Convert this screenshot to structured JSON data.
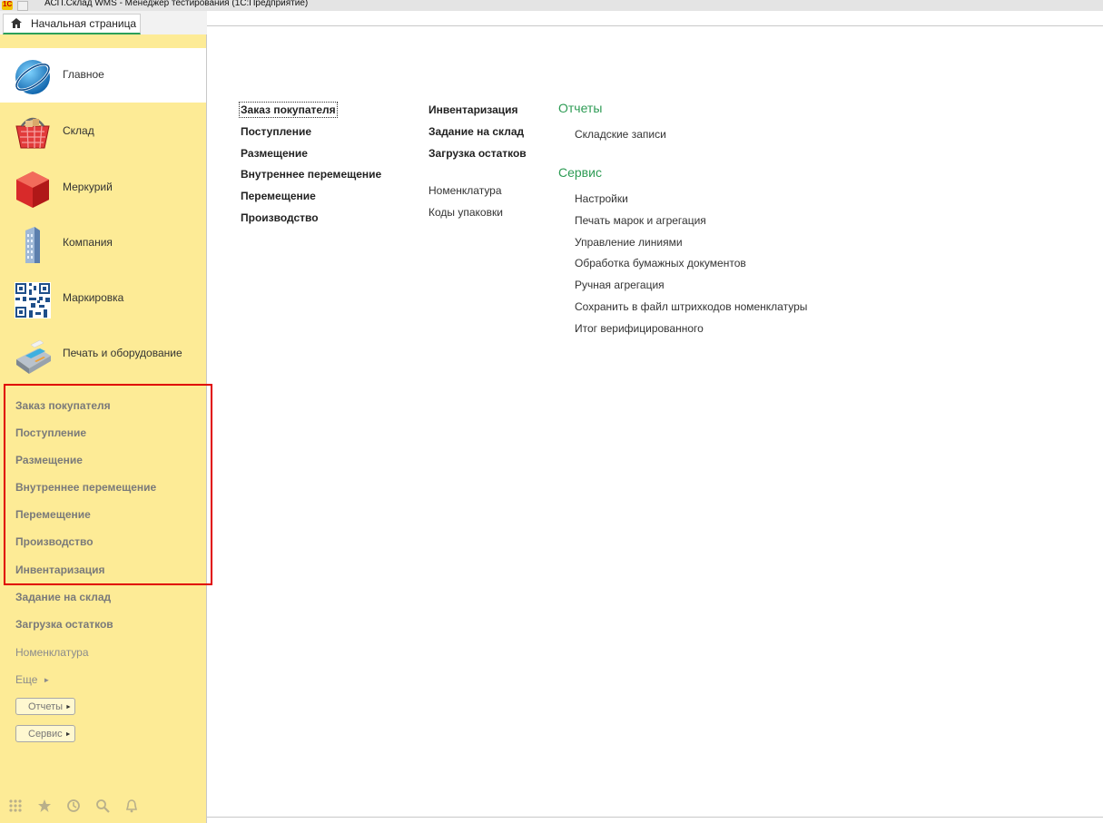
{
  "window": {
    "title": "АСП.Склад WMS - Менеджер тестирования (1С:Предприятие)"
  },
  "home_tab": {
    "label": "Начальная страница"
  },
  "sections": [
    {
      "label": "Главное",
      "icon": "globe-icon",
      "active": true
    },
    {
      "label": "Склад",
      "icon": "basket-icon"
    },
    {
      "label": "Меркурий",
      "icon": "cube-icon"
    },
    {
      "label": "Компания",
      "icon": "building-icon"
    },
    {
      "label": "Маркировка",
      "icon": "qr-code-icon"
    },
    {
      "label": "Печать и оборудование",
      "icon": "printer-icon"
    }
  ],
  "nav": {
    "items": [
      "Заказ покупателя",
      "Поступление",
      "Размещение",
      "Внутреннее перемещение",
      "Перемещение",
      "Производство",
      "Инвентаризация",
      "Задание на склад",
      "Загрузка остатков"
    ],
    "plain": "Номенклатура",
    "more": "Еще",
    "reports_btn": "Отчеты",
    "service_btn": "Сервис"
  },
  "content": {
    "col1": [
      "Заказ покупателя",
      "Поступление",
      "Размещение",
      "Внутреннее перемещение",
      "Перемещение",
      "Производство"
    ],
    "col2_bold": [
      "Инвентаризация",
      "Задание на склад",
      "Загрузка остатков"
    ],
    "col2_plain": [
      "Номенклатура",
      "Коды упаковки"
    ],
    "reports_header": "Отчеты",
    "reports": [
      "Складские записи"
    ],
    "service_header": "Сервис",
    "service": [
      "Настройки",
      "Печать марок и агрегация",
      "Управление линиями",
      "Обработка бумажных документов",
      "Ручная агрегация",
      "Сохранить в файл штрихкодов номенклатуры",
      "Итог верифицированного"
    ]
  },
  "colors": {
    "sidebar_bg": "#fdeb96",
    "accent_green": "#2d9b54",
    "highlight_red": "#e00000"
  }
}
